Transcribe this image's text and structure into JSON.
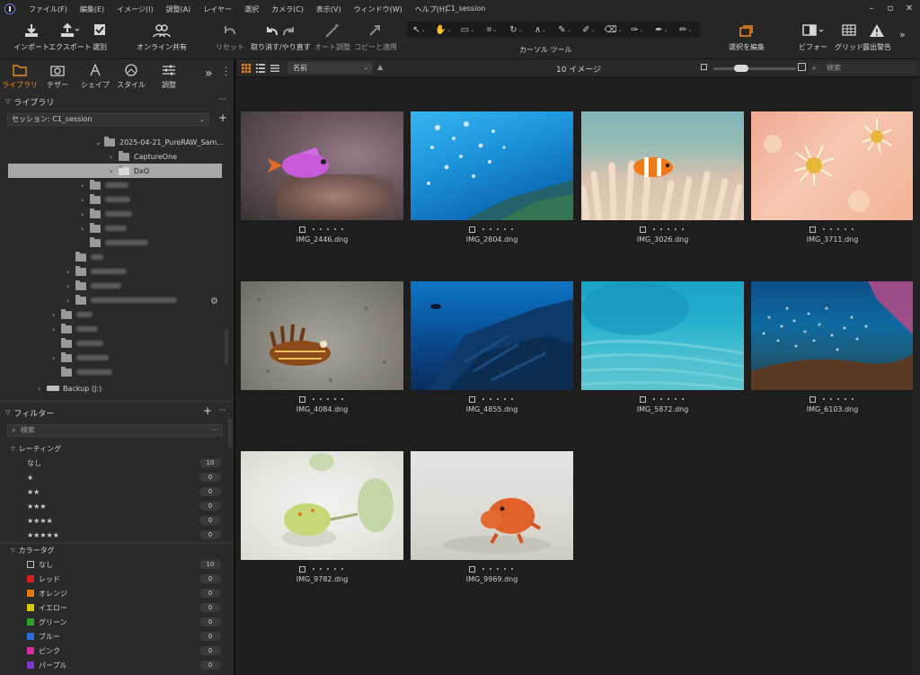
{
  "titlebar": {
    "menus": [
      "ファイル(F)",
      "編集(E)",
      "イメージ(I)",
      "調整(A)",
      "レイヤー",
      "選択",
      "カメラ(C)",
      "表示(V)",
      "ウィンドウ(W)",
      "ヘルプ(H)"
    ],
    "title": "C1_session"
  },
  "toolbar": {
    "import": "インポート",
    "export": "エクスポート",
    "select": "選別",
    "online_share": "オンライン共有",
    "reset": "リセット",
    "undo_redo": "取り消す/やり直す",
    "auto_adjust": "オート調整",
    "copy_apply": "コピーと適用",
    "cursor_tools": "カーソル ツール",
    "select_edit": "選択を編集",
    "before": "ビフォー",
    "grid": "グリッド",
    "exposure_warning": "露出警告"
  },
  "tool_tabs": [
    "ライブラリ",
    "テザー",
    "シェイプ",
    "スタイル",
    "調整"
  ],
  "library": {
    "header": "ライブラリ",
    "session": "セッション: C1_session",
    "tree": {
      "root_folder": "2025-04-21_PureRAW_Sam...",
      "child1": "CaptureOne",
      "child2": "DxO",
      "drive": "Backup (J:)"
    }
  },
  "filter": {
    "header": "フィルター",
    "search_placeholder": "検索",
    "rating_header": "レーティング",
    "ratings": [
      {
        "label": "なし",
        "count": "10"
      },
      {
        "label": "★",
        "count": "0"
      },
      {
        "label": "★★",
        "count": "0"
      },
      {
        "label": "★★★",
        "count": "0"
      },
      {
        "label": "★★★★",
        "count": "0"
      },
      {
        "label": "★★★★★",
        "count": "0"
      }
    ],
    "color_header": "カラータグ",
    "colors": [
      {
        "label": "なし",
        "count": "10",
        "color": "none"
      },
      {
        "label": "レッド",
        "count": "0",
        "color": "#d62020"
      },
      {
        "label": "オレンジ",
        "count": "0",
        "color": "#e07a10"
      },
      {
        "label": "イエロー",
        "count": "0",
        "color": "#d8c812"
      },
      {
        "label": "グリーン",
        "count": "0",
        "color": "#2fa02f"
      },
      {
        "label": "ブルー",
        "count": "0",
        "color": "#2a6fd6"
      },
      {
        "label": "ピンク",
        "count": "0",
        "color": "#d42fa0"
      },
      {
        "label": "パープル",
        "count": "0",
        "color": "#7a3ad0"
      }
    ]
  },
  "browser": {
    "sort": "名前",
    "count_label": "10 イメージ",
    "search_placeholder": "検索",
    "images": [
      {
        "name": "IMG_2446.dng"
      },
      {
        "name": "IMG_2804.dng"
      },
      {
        "name": "IMG_3026.dng"
      },
      {
        "name": "IMG_3711.dng"
      },
      {
        "name": "IMG_4084.dng"
      },
      {
        "name": "IMG_4855.dng"
      },
      {
        "name": "IMG_5872.dng"
      },
      {
        "name": "IMG_6103.dng"
      },
      {
        "name": "IMG_9782.dng"
      },
      {
        "name": "IMG_9969.dng"
      }
    ]
  },
  "colors": {
    "accent": "#f08a1c",
    "background": "#1e1e1e",
    "panel": "#2a2a2a"
  }
}
